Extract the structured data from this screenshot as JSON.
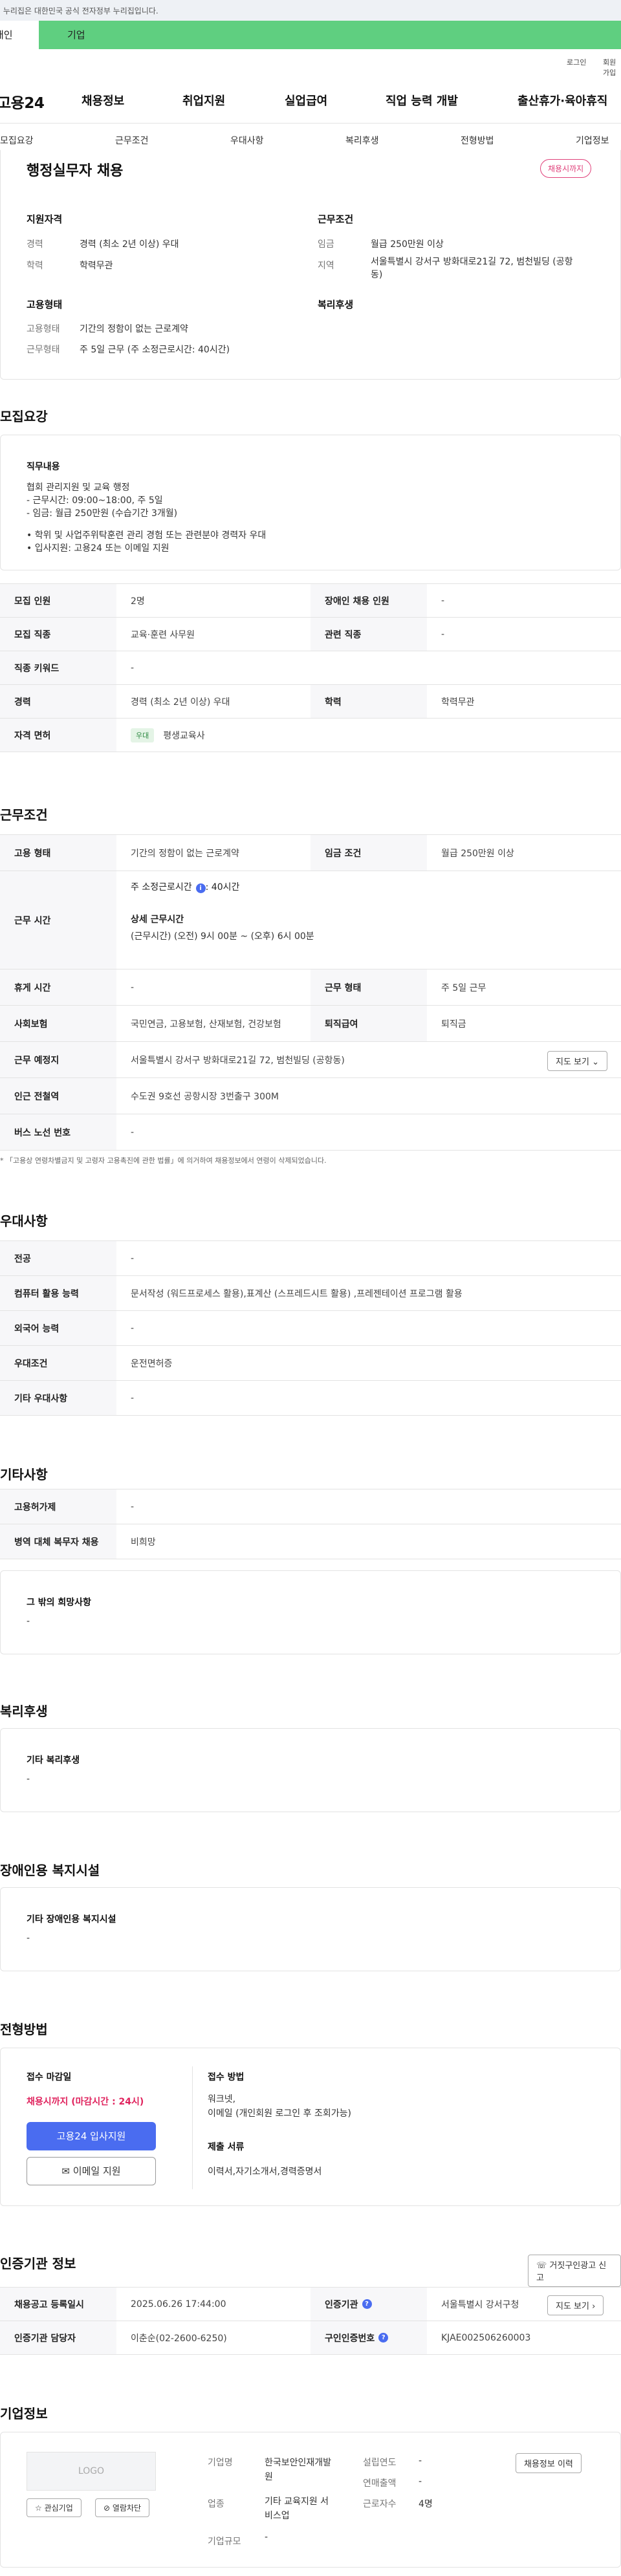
{
  "gov_banner": "이 누리집은 대한민국 공식 전자정부 누리집입니다.",
  "tabs": {
    "individual": "개인",
    "corporate": "기업"
  },
  "util": {
    "login": "로그인",
    "join": "회원가입"
  },
  "logo": "고용24",
  "gnb": [
    "채용정보",
    "취업지원",
    "실업급여",
    "직업 능력 개발",
    "출산휴가·육아휴직"
  ],
  "subnav": [
    "모집요강",
    "근무조건",
    "우대사항",
    "복리후생",
    "전형방법",
    "기업정보"
  ],
  "summary": {
    "title": "행정실무자 채용",
    "badge": "채용시까지",
    "qual_heading": "지원자격",
    "career_label": "경력",
    "career_value": "경력 (최소 2년 이상) 우대",
    "edu_label": "학력",
    "edu_value": "학력무관",
    "cond_heading": "근무조건",
    "wage_label": "임금",
    "wage_value": "월급 250만원 이상",
    "region_label": "지역",
    "region_value_1": "서울특별시 강서구 방화대로21길 72, 범천빌딩 (공항",
    "region_value_2": "동)",
    "emp_heading": "고용형태",
    "emptype_label": "고용형태",
    "emptype_value": "기간의 정함이 없는 근로계약",
    "worktype_label": "근무형태",
    "worktype_value": "주 5일 근무 (주 소정근로시간: 40시간)",
    "welfare_heading": "복리후생"
  },
  "recruit": {
    "heading": "모집요강",
    "duty_heading": "직무내용",
    "duty_lines": [
      "협회 관리지원 및 교육 행정",
      "- 근무시간: 09:00~18:00, 주 5일",
      "- 임금: 월급 250만원 (수습기간 3개월)",
      "",
      "• 학위 및  사업주위탁훈련 관리 경험 또는 관련분야 경력자 우대",
      "• 입사지원: 고용24 또는 이메일 지원"
    ],
    "rows": [
      {
        "l1": "모집 인원",
        "v1": "2명",
        "l2": "장애인 채용 인원",
        "v2": "-"
      },
      {
        "l1": "모집 직종",
        "v1": "교육·훈련 사무원",
        "l2": "관련 직종",
        "v2": "-"
      },
      {
        "l1": "직종 키워드",
        "v1": "-"
      },
      {
        "l1": "경력",
        "v1": "경력 (최소 2년 이상) 우대",
        "l2": "학력",
        "v2": "학력무관"
      },
      {
        "l1": "자격 면허",
        "tag": "우대",
        "v1": "평생교육사"
      }
    ]
  },
  "conditions": {
    "heading": "근무조건",
    "emptype_l": "고용 형태",
    "emptype_v": "기간의 정함이 없는 근로계약",
    "wage_l": "임금 조건",
    "wage_v": "월급 250만원 이상",
    "hours_l": "근무 시간",
    "hours_main": "주 소정근로시간",
    "hours_main_val": ": 40시간",
    "hours_detail_h": "상세 근무시간",
    "hours_detail": "(근무시간) (오전) 9시 00분 ~ (오후) 6시 00분",
    "rest_l": "휴게 시간",
    "rest_v": "-",
    "shift_l": "근무 형태",
    "shift_v": "주 5일 근무",
    "ins_l": "사회보험",
    "ins_v": "국민연금, 고용보험, 산재보험, 건강보험",
    "sev_l": "퇴직급여",
    "sev_v": "퇴직금",
    "loc_l": "근무 예정지",
    "loc_v": "서울특별시 강서구 방화대로21길 72, 범천빌딩 (공항동)",
    "map_btn": "지도 보기",
    "subway_l": "인근 전철역",
    "subway_v": "수도권 9호선 공항시장 3번출구 300M",
    "bus_l": "버스 노선 번호",
    "bus_v": "-",
    "note": "* 「고용상 연령차별금지 및 고령자 고용촉진에 관한 법률」에 의거하여 채용정보에서 연령이 삭제되었습니다."
  },
  "pref": {
    "heading": "우대사항",
    "rows": [
      {
        "l": "전공",
        "v": "-"
      },
      {
        "l": "컴퓨터 활용 능력",
        "v": "문서작성 (워드프로세스 활용),표계산 (스프레드시트 활용) ,프레젠테이션 프로그램 활용"
      },
      {
        "l": "외국어 능력",
        "v": "-"
      },
      {
        "l": "우대조건",
        "v": "운전면허증"
      },
      {
        "l": "기타 우대사항",
        "v": "-"
      }
    ]
  },
  "etc": {
    "heading": "기타사항",
    "rows": [
      {
        "l": "고용허가제",
        "v": "-"
      },
      {
        "l": "병역 대체 복무자 채용",
        "v": "비희망"
      }
    ],
    "other_h": "그 밖의 희망사항",
    "other_v": "-"
  },
  "welfare": {
    "heading": "복리후생",
    "box_h": "기타 복리후생",
    "box_v": "-"
  },
  "disab": {
    "heading": "장애인용 복지시설",
    "box_h": "기타 장애인용 복지시설",
    "box_v": "-"
  },
  "apply": {
    "heading": "전형방법",
    "deadline_h": "접수 마감일",
    "deadline_v": "채용시까지 (마감시간 : 24시)",
    "apply_btn": "고용24 입사지원",
    "email_btn": "이메일 지원",
    "method_h": "접수 방법",
    "method_v1": "워크넷,",
    "method_v2": "이메일 (개인회원 로그인 후 조회가능)",
    "docs_h": "제출 서류",
    "docs_v": "이력서,자기소개서,경력증명서"
  },
  "cert": {
    "heading": "인증기관 정보",
    "report_btn": "거짓구인광고 신고",
    "reg_l": "채용공고 등록일시",
    "reg_v": "2025.06.26 17:44:00",
    "org_l": "인증기관",
    "org_v": "서울특별시 강서구청",
    "map_btn": "지도 보기",
    "mgr_l": "인증기관 담당자",
    "mgr_v": "이춘순(02-2600-6250)",
    "no_l": "구인인증번호",
    "no_v": "KJAE002506260003"
  },
  "company": {
    "heading": "기업정보",
    "logo_text": "LOGO",
    "fav_btn": "관심기업",
    "block_btn": "열람차단",
    "name_l": "기업명",
    "name_v1": "한국보안인재개발",
    "name_v2": "원",
    "ind_l": "업종",
    "ind_v1": "기타 교육지원 서",
    "ind_v2": "비스업",
    "size_l": "기업규모",
    "size_v": "-",
    "year_l": "설립연도",
    "year_v": "-",
    "sales_l": "연매출액",
    "sales_v": "-",
    "emp_l": "근로자수",
    "emp_v": "4명",
    "more_btn": "채용정보 이력"
  }
}
